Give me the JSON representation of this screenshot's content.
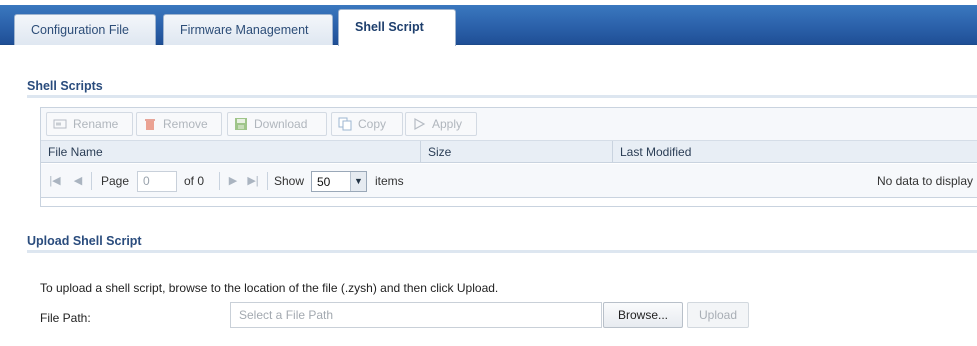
{
  "tabs": [
    {
      "label": "Configuration File"
    },
    {
      "label": "Firmware Management"
    },
    {
      "label": "Shell Script"
    }
  ],
  "shell_scripts": {
    "title": "Shell Scripts",
    "toolbar": {
      "rename": "Rename",
      "remove": "Remove",
      "download": "Download",
      "copy": "Copy",
      "apply": "Apply"
    },
    "columns": [
      "File Name",
      "Size",
      "Last Modified"
    ],
    "pager": {
      "page_label": "Page",
      "page_value": "0",
      "of_label": "of 0",
      "show_label": "Show",
      "show_value": "50",
      "items_label": "items",
      "no_data": "No data to display"
    }
  },
  "upload": {
    "title": "Upload Shell Script",
    "description": "To upload a shell script, browse to the location of the file (.zysh) and then click Upload.",
    "file_path_label": "File Path:",
    "file_path_placeholder": "Select a File Path",
    "browse_label": "Browse...",
    "upload_label": "Upload"
  },
  "colors": {
    "tabbar": "#2a5fa8",
    "section_title": "#2a4c7d",
    "disabled_text": "#b0b6bd"
  }
}
